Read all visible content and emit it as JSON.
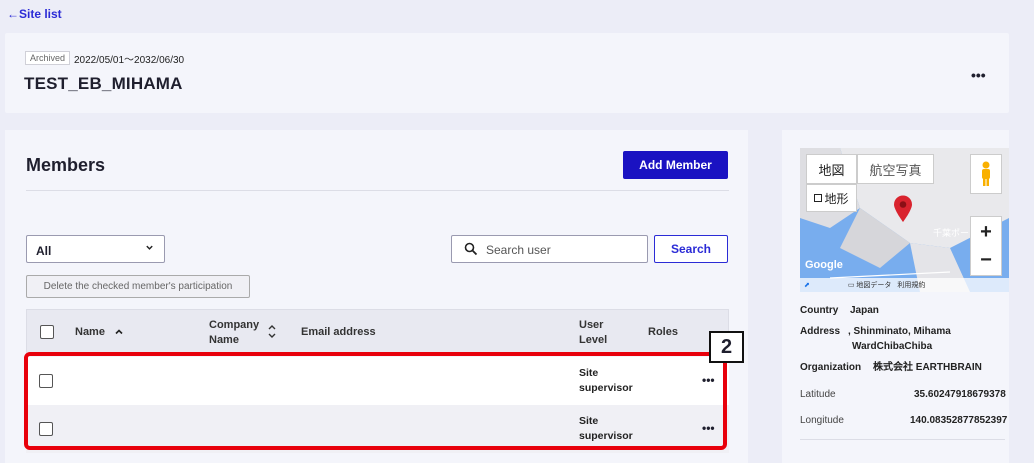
{
  "nav": {
    "back_label": "←Site list"
  },
  "header": {
    "badge": "Archived",
    "dates": "2022/05/01～2032/06/30",
    "title": "TEST_EB_MIHAMA",
    "more": "•••"
  },
  "members": {
    "title": "Members",
    "add_button": "Add Member",
    "filter_value": "All",
    "search_placeholder": "Search user",
    "search_button": "Search",
    "delete_button": "Delete the checked member's participation",
    "columns": {
      "name": "Name",
      "company": [
        "Company",
        "Name"
      ],
      "email": "Email address",
      "user_level": [
        "User",
        "Level"
      ],
      "roles": "Roles"
    },
    "rows": [
      {
        "name": "",
        "company": "",
        "email": "",
        "level": [
          "Site",
          "supervisor"
        ],
        "roles": "",
        "more": "•••"
      },
      {
        "name": "",
        "company": "",
        "email": "",
        "level": [
          "Site",
          "supervisor"
        ],
        "roles": "",
        "more": "•••"
      }
    ],
    "annotation_number": "2"
  },
  "map": {
    "tab_map": "地図",
    "tab_satellite": "航空写真",
    "terrain": "地形",
    "place_label": "千葉ポー",
    "google": "Google",
    "map_data": "地図データ",
    "terms": "利用規約",
    "zoom_in": "+",
    "zoom_out": "−"
  },
  "site": {
    "country_label": "Country",
    "country": "Japan",
    "address_label": "Address",
    "address": [
      ", Shinminato, Mihama",
      "WardChibaChiba"
    ],
    "organization_label": "Organization",
    "organization": "株式会社 EARTHBRAIN",
    "latitude_label": "Latitude",
    "latitude": "35.60247918679378",
    "longitude_label": "Longitude",
    "longitude": "140.08352877852397"
  },
  "colors": {
    "accent": "#1a12c2",
    "highlight": "#e8000b",
    "map_water": "#78adee",
    "pin": "#d9232e"
  }
}
